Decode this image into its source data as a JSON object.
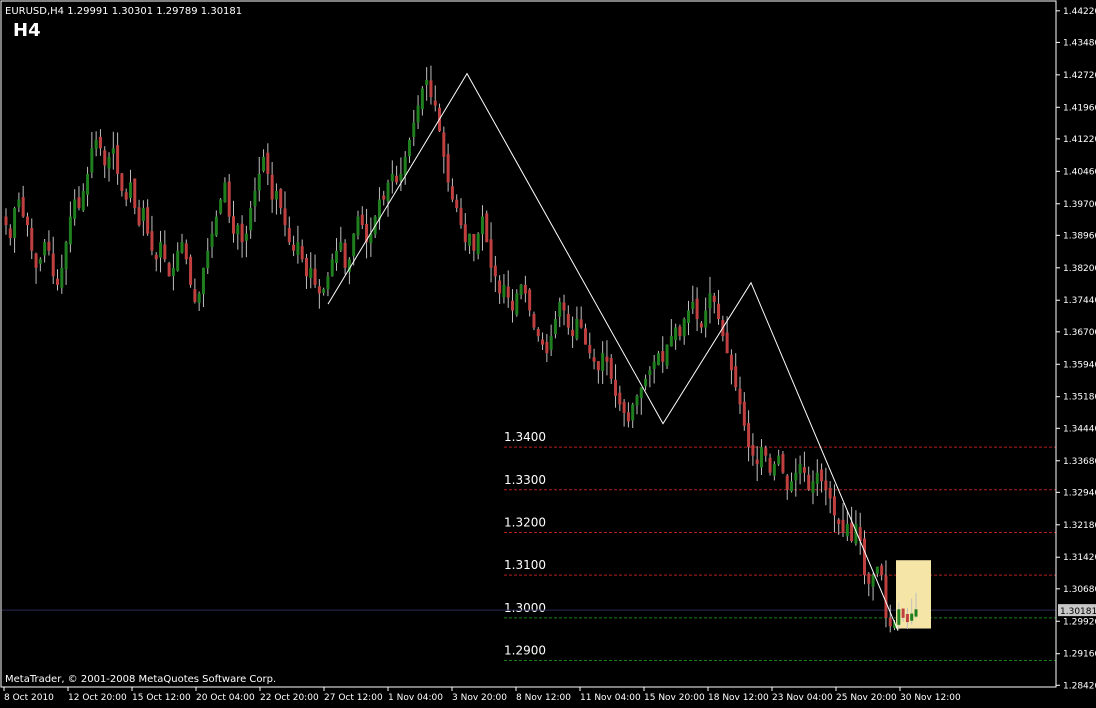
{
  "window": {
    "symbol_line": "EURUSD,H4  1.29991 1.30301 1.29789 1.30181",
    "timeframe": "H4",
    "copyright": "MetaTrader, © 2001-2008 MetaQuotes Software Corp."
  },
  "colors": {
    "background": "#000000",
    "frame": "#ffffff",
    "bull_candle": "#1f7f1f",
    "bear_candle": "#c04040",
    "wick": "#bfbfbf",
    "zigzag": "#ffffff",
    "level_red": "#b02020",
    "level_green": "#1a7f1a",
    "highlight_box": "#f5e6a8",
    "price_badge_bg": "#c8c8c8",
    "grid": "#1a1a1a"
  },
  "chart_data": {
    "type": "candlestick",
    "symbol": "EURUSD",
    "timeframe": "H4",
    "current_price": 1.30181,
    "ohlc_last": {
      "open": 1.29991,
      "high": 1.30301,
      "low": 1.29789,
      "close": 1.30181
    },
    "ylim": [
      1.2838,
      1.4445
    ],
    "y_ticks": [
      "1.44220",
      "1.43480",
      "1.42720",
      "1.41960",
      "1.41220",
      "1.40460",
      "1.39700",
      "1.38960",
      "1.38200",
      "1.37440",
      "1.36700",
      "1.35940",
      "1.35180",
      "1.34440",
      "1.33680",
      "1.32940",
      "1.32180",
      "1.31420",
      "1.30680",
      "1.29920",
      "1.29160",
      "1.28420"
    ],
    "x_ticks": [
      "8 Oct 2010",
      "12 Oct 20:00",
      "15 Oct 12:00",
      "20 Oct 04:00",
      "22 Oct 20:00",
      "27 Oct 12:00",
      "1 Nov 04:00",
      "3 Nov 20:00",
      "8 Nov 12:00",
      "11 Nov 04:00",
      "15 Nov 20:00",
      "18 Nov 12:00",
      "23 Nov 04:00",
      "25 Nov 20:00",
      "30 Nov 12:00"
    ],
    "zigzag": [
      {
        "date": "27 Oct",
        "price": 1.3735
      },
      {
        "date": "4 Nov",
        "price": 1.4275
      },
      {
        "date": "16 Nov",
        "price": 1.3455
      },
      {
        "date": "19 Nov",
        "price": 1.3785
      },
      {
        "date": "30 Nov",
        "price": 1.297
      }
    ],
    "levels": [
      {
        "label": "1.3400",
        "price": 1.34,
        "color": "red"
      },
      {
        "label": "1.3300",
        "price": 1.33,
        "color": "red"
      },
      {
        "label": "1.3200",
        "price": 1.32,
        "color": "red"
      },
      {
        "label": "1.3100",
        "price": 1.31,
        "color": "red"
      },
      {
        "label": "1.3000",
        "price": 1.3,
        "color": "green"
      },
      {
        "label": "1.2900",
        "price": 1.29,
        "color": "green"
      }
    ],
    "highlight_box": {
      "price_top": 1.3135,
      "price_bottom": 1.2975
    },
    "closes": [
      1.392,
      1.389,
      1.396,
      1.398,
      1.394,
      1.392,
      1.386,
      1.382,
      1.384,
      1.388,
      1.386,
      1.38,
      1.378,
      1.382,
      1.388,
      1.394,
      1.398,
      1.396,
      1.4,
      1.404,
      1.41,
      1.412,
      1.41,
      1.406,
      1.408,
      1.41,
      1.404,
      1.4,
      1.398,
      1.402,
      1.396,
      1.392,
      1.396,
      1.39,
      1.386,
      1.384,
      1.388,
      1.384,
      1.38,
      1.382,
      1.386,
      1.388,
      1.384,
      1.378,
      1.374,
      1.376,
      1.382,
      1.386,
      1.39,
      1.394,
      1.398,
      1.402,
      1.394,
      1.39,
      1.392,
      1.388,
      1.39,
      1.396,
      1.4,
      1.404,
      1.408,
      1.404,
      1.398,
      1.4,
      1.396,
      1.392,
      1.388,
      1.386,
      1.388,
      1.384,
      1.38,
      1.382,
      1.378,
      1.376,
      1.377,
      1.38,
      1.384,
      1.386,
      1.388,
      1.382,
      1.384,
      1.39,
      1.394,
      1.392,
      1.388,
      1.39,
      1.394,
      1.398,
      1.398,
      1.402,
      1.404,
      1.402,
      1.404,
      1.408,
      1.412,
      1.416,
      1.42,
      1.424,
      1.426,
      1.422,
      1.42,
      1.414,
      1.408,
      1.402,
      1.398,
      1.396,
      1.392,
      1.388,
      1.39,
      1.386,
      1.39,
      1.394,
      1.388,
      1.382,
      1.38,
      1.376,
      1.378,
      1.375,
      1.372,
      1.376,
      1.378,
      1.376,
      1.372,
      1.368,
      1.366,
      1.364,
      1.362,
      1.366,
      1.37,
      1.374,
      1.372,
      1.368,
      1.366,
      1.37,
      1.368,
      1.364,
      1.362,
      1.36,
      1.358,
      1.362,
      1.36,
      1.356,
      1.352,
      1.35,
      1.348,
      1.346,
      1.35,
      1.352,
      1.354,
      1.356,
      1.358,
      1.36,
      1.362,
      1.36,
      1.364,
      1.366,
      1.368,
      1.366,
      1.37,
      1.372,
      1.374,
      1.37,
      1.368,
      1.372,
      1.376,
      1.374,
      1.37,
      1.366,
      1.362,
      1.358,
      1.354,
      1.35,
      1.345,
      1.34,
      1.338,
      1.336,
      1.34,
      1.338,
      1.334,
      1.336,
      1.338,
      1.334,
      1.33,
      1.332,
      1.334,
      1.336,
      1.334,
      1.33,
      1.332,
      1.334,
      1.332,
      1.33,
      1.328,
      1.324,
      1.322,
      1.32,
      1.322,
      1.318,
      1.322,
      1.318,
      1.31,
      1.308,
      1.31,
      1.312,
      1.31,
      1.3,
      1.298,
      1.299,
      1.302,
      1.3,
      1.299,
      1.301,
      1.302
    ]
  },
  "badge_price": "1.30181"
}
